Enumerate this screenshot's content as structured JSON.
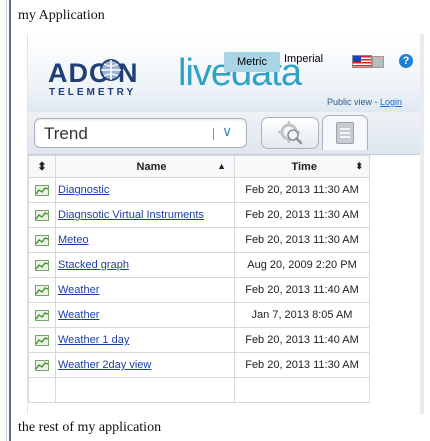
{
  "page": {
    "app_title": "my Application",
    "rest_text": "the rest of my application"
  },
  "header": {
    "brand_top": "ADC  N",
    "brand_bottom": "TELEMETRY",
    "livedata": "livedata",
    "metric_label": "Metric",
    "imperial_label": "Imperial",
    "help_icon": "?",
    "public_view": "Public view - ",
    "login_label": "Login"
  },
  "toolbar": {
    "dropdown_value": "Trend",
    "dropdown_chevron": "∨"
  },
  "table": {
    "headers": {
      "sort": "⬍",
      "name": "Name",
      "name_sort": "▲",
      "time": "Time",
      "time_sort": "⬍"
    },
    "rows": [
      {
        "name": "Diagnostic",
        "time": "Feb 20, 2013 11:30 AM"
      },
      {
        "name": "Diagnsotic Virtual Instruments",
        "time": "Feb 20, 2013 11:30 AM"
      },
      {
        "name": "Meteo",
        "time": "Feb 20, 2013 11:30 AM"
      },
      {
        "name": "Stacked graph",
        "time": "Aug 20, 2009 2:20 PM"
      },
      {
        "name": "Weather",
        "time": "Feb 20, 2013 11:40 AM"
      },
      {
        "name": "Weather",
        "time": "Jan 7, 2013 8:05 AM"
      },
      {
        "name": "Weather 1 day",
        "time": "Feb 20, 2013 11:40 AM"
      },
      {
        "name": "Weather 2day view",
        "time": "Feb 20, 2013 11:30 AM"
      }
    ]
  },
  "icons": {
    "row_icon": "chart-icon",
    "search": "search-gear-icon",
    "document": "document-icon",
    "flag": "us-flag-icon",
    "help": "help-icon"
  },
  "colors": {
    "accent_blue": "#2fa3c6",
    "adcon_navy": "#1f3f77",
    "link": "#1a3ea8",
    "metric_bg": "#a8d4e6"
  }
}
